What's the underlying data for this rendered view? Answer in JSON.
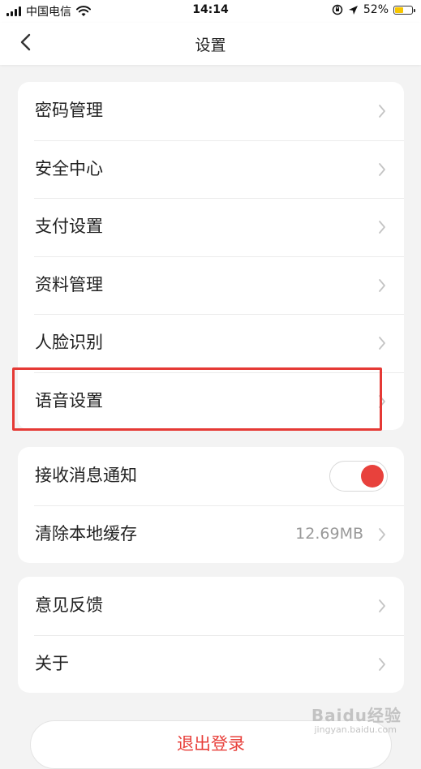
{
  "status_bar": {
    "carrier": "中国电信",
    "time": "14:14",
    "battery_percent": "52%",
    "battery_level": 0.52,
    "icons": [
      "signal-icon",
      "wifi-icon",
      "orientation-lock-icon",
      "location-icon",
      "battery-icon"
    ]
  },
  "nav": {
    "title": "设置",
    "back_icon": "chevron-left-icon"
  },
  "group1": {
    "items": [
      {
        "label": "密码管理"
      },
      {
        "label": "安全中心"
      },
      {
        "label": "支付设置"
      },
      {
        "label": "资料管理"
      },
      {
        "label": "人脸识别"
      },
      {
        "label": "语音设置"
      }
    ]
  },
  "group2": {
    "notifications": {
      "label": "接收消息通知",
      "enabled": true
    },
    "cache": {
      "label": "清除本地缓存",
      "value": "12.69MB"
    }
  },
  "group3": {
    "items": [
      {
        "label": "意见反馈"
      },
      {
        "label": "关于"
      }
    ]
  },
  "logout": {
    "label": "退出登录"
  },
  "watermark": {
    "text": "Baidu经验",
    "sub": "jingyan.baidu.com"
  },
  "colors": {
    "accent": "#e8413c",
    "highlight": "#e53935",
    "background": "#f3f3f3",
    "card": "#ffffff"
  }
}
